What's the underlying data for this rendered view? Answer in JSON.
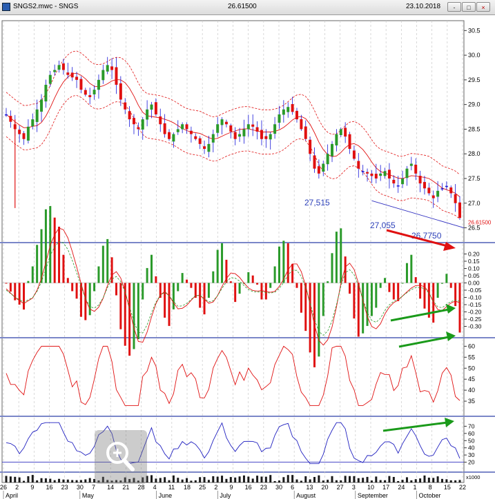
{
  "window": {
    "file_title": "SNGS2.mwc - SNGS",
    "last_price": "26.61500",
    "date": "23.10.2018",
    "buttons": [
      "-",
      "□",
      "×"
    ]
  },
  "chart_data": [
    {
      "panel": "price",
      "type": "candlestick",
      "symbol": "SNGS",
      "last_value": "26.61500",
      "ylim": [
        26.2,
        30.7
      ],
      "y_ticks": [
        "30.5",
        "30.0",
        "29.5",
        "29.0",
        "28.5",
        "28.0",
        "27.5",
        "27.0",
        "26.5"
      ],
      "approx_close": [
        28.8,
        28.65,
        28.5,
        28.4,
        28.3,
        28.55,
        28.7,
        28.9,
        29.1,
        29.4,
        29.6,
        29.7,
        29.8,
        29.7,
        29.6,
        29.55,
        29.5,
        29.3,
        29.2,
        29.15,
        29.3,
        29.5,
        29.7,
        29.8,
        29.7,
        29.4,
        29.1,
        28.9,
        28.7,
        28.6,
        28.5,
        28.7,
        28.9,
        29.0,
        28.8,
        28.6,
        28.4,
        28.3,
        28.4,
        28.5,
        28.6,
        28.5,
        28.4,
        28.3,
        28.2,
        28.1,
        28.2,
        28.4,
        28.6,
        28.7,
        28.6,
        28.45,
        28.3,
        28.4,
        28.5,
        28.6,
        28.55,
        28.45,
        28.3,
        28.3,
        28.4,
        28.6,
        28.8,
        28.9,
        28.95,
        28.85,
        28.7,
        28.5,
        28.3,
        28.0,
        27.7,
        27.6,
        27.8,
        28.0,
        28.2,
        28.4,
        28.5,
        28.35,
        28.1,
        27.9,
        27.7,
        27.65,
        27.6,
        27.55,
        27.5,
        27.6,
        27.65,
        27.5,
        27.4,
        27.35,
        27.5,
        27.7,
        27.8,
        27.6,
        27.4,
        27.3,
        27.2,
        27.1,
        27.25,
        27.3,
        27.35,
        27.2,
        27.0,
        26.7
      ],
      "envelope_bands": [
        "upper",
        "middle",
        "lower"
      ],
      "annotations": [
        "27,515",
        "27,055",
        "26,7750"
      ]
    },
    {
      "panel": "macd",
      "type": "histogram+line",
      "ylim": [
        -0.35,
        0.25
      ],
      "y_ticks": [
        "0.20",
        "0.15",
        "0.10",
        "0.05",
        "0.00",
        "-0.05",
        "-0.10",
        "-0.15",
        "-0.20",
        "-0.25",
        "-0.30"
      ]
    },
    {
      "panel": "oscillator",
      "type": "line",
      "ylim": [
        30,
        62
      ],
      "y_ticks": [
        "60",
        "55",
        "50",
        "45",
        "40",
        "35"
      ]
    },
    {
      "panel": "oscillator2",
      "type": "line",
      "ylim": [
        10,
        80
      ],
      "y_ticks": [
        "70",
        "60",
        "50",
        "40",
        "30",
        "20"
      ]
    },
    {
      "panel": "volume",
      "scale_label": "x1000",
      "type": "bar"
    }
  ],
  "x_axis": {
    "day_ticks": [
      "26",
      "2",
      "9",
      "16",
      "23",
      "30",
      "7",
      "14",
      "21",
      "28",
      "4",
      "11",
      "18",
      "25",
      "2",
      "9",
      "16",
      "23",
      "30",
      "6",
      "13",
      "20",
      "27",
      "3",
      "10",
      "17",
      "24",
      "1",
      "8",
      "15",
      "22"
    ],
    "month_labels": [
      "April",
      "May",
      "June",
      "July",
      "August",
      "September",
      "October"
    ]
  },
  "colors": {
    "up": "#2a9a2a",
    "down": "#e01010",
    "flat": "#1515d8",
    "band": "#e01010",
    "arrow_red": "#e01010",
    "arrow_green": "#1a9a1a",
    "line_blue": "#2020c0",
    "grid": "#c8c8c8",
    "separator": "#7a86c8"
  }
}
